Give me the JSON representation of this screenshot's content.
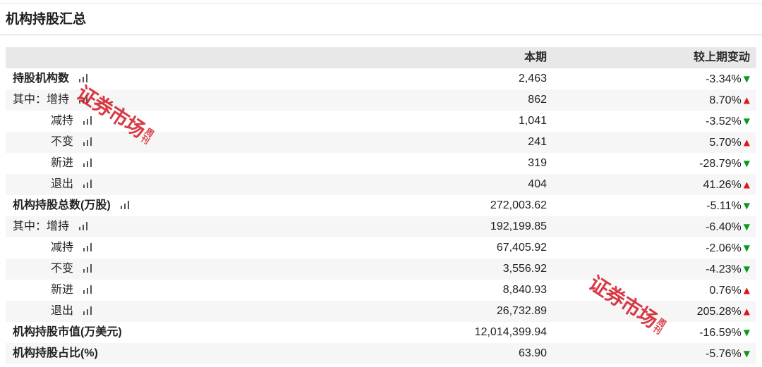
{
  "title": "机构持股汇总",
  "header": {
    "current": "本期",
    "change": "较上期变动"
  },
  "rows": [
    {
      "label": "持股机构数",
      "current": "2,463",
      "change": "-3.34%",
      "arrow": "▼"
    },
    {
      "label": "其中：增持",
      "current": "862",
      "change": "8.70%",
      "arrow": "▲"
    },
    {
      "label": "减持",
      "current": "1,041",
      "change": "-3.52%",
      "arrow": "▼"
    },
    {
      "label": "不变",
      "current": "241",
      "change": "5.70%",
      "arrow": "▲"
    },
    {
      "label": "新进",
      "current": "319",
      "change": "-28.79%",
      "arrow": "▼"
    },
    {
      "label": "退出",
      "current": "404",
      "change": "41.26%",
      "arrow": "▲"
    },
    {
      "label": "机构持股总数(万股)",
      "current": "272,003.62",
      "change": "-5.11%",
      "arrow": "▼"
    },
    {
      "label": "其中：增持",
      "current": "192,199.85",
      "change": "-6.40%",
      "arrow": "▼"
    },
    {
      "label": "减持",
      "current": "67,405.92",
      "change": "-2.06%",
      "arrow": "▼"
    },
    {
      "label": "不变",
      "current": "3,556.92",
      "change": "-4.23%",
      "arrow": "▼"
    },
    {
      "label": "新进",
      "current": "8,840.93",
      "change": "0.76%",
      "arrow": "▲"
    },
    {
      "label": "退出",
      "current": "26,732.89",
      "change": "205.28%",
      "arrow": "▲"
    },
    {
      "label": "机构持股市值(万美元)",
      "current": "12,014,399.94",
      "change": "-16.59%",
      "arrow": "▼"
    },
    {
      "label": "机构持股占比(%)",
      "current": "63.90",
      "change": "-5.76%",
      "arrow": "▼"
    }
  ],
  "icons": {
    "row_chart": "bar-chart-icon",
    "increase": "triangle-up-icon",
    "decrease": "triangle-down-icon"
  },
  "colors": {
    "increase": "#e3141a",
    "decrease": "#0a9a1e",
    "header_bg": "#e8e8e8",
    "stripe_bg": "#f6f6f6",
    "watermark": "#d4202c"
  },
  "watermark": {
    "main": "证券市场",
    "sub": "周刊"
  }
}
